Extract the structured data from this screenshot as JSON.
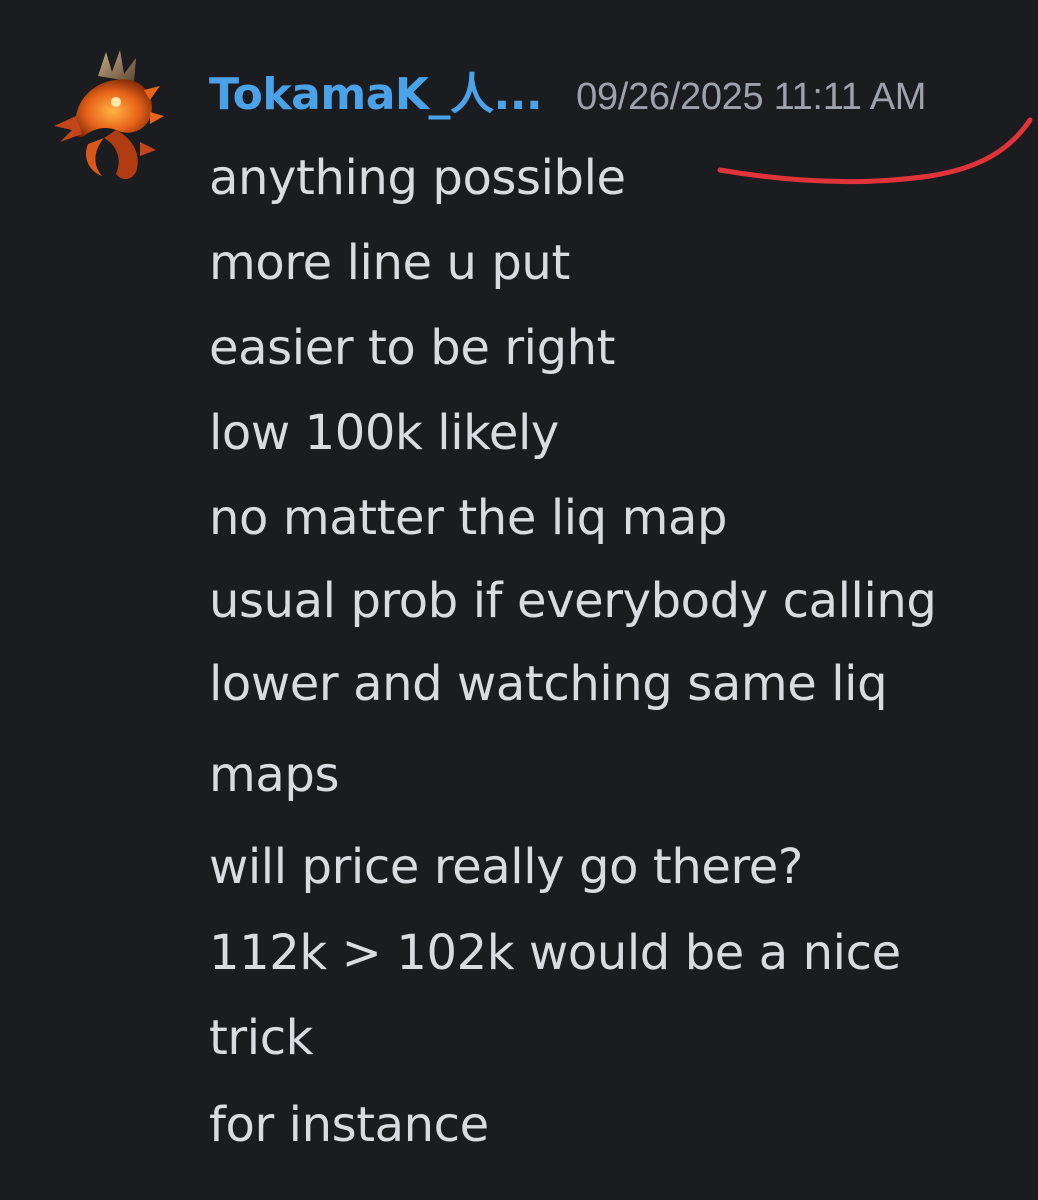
{
  "message": {
    "author": "TokamaK_人...",
    "timestamp": "09/26/2025 11:11 AM",
    "avatar_icon": "dragon-avatar-icon",
    "lines": [
      "anything possible",
      "more line u put",
      "easier to be right",
      "low 100k likely",
      "no matter the liq map",
      "usual prob if everybody calling",
      "lower and watching same liq",
      "maps",
      "will price really go there?",
      "112k > 102k would be a nice",
      "trick",
      "for instance"
    ]
  },
  "colors": {
    "background": "#1b1c20",
    "username": "#4aa3e8",
    "timestamp": "#9ea2ab",
    "text": "#d9dbe0",
    "annotation": "#e0343a"
  }
}
